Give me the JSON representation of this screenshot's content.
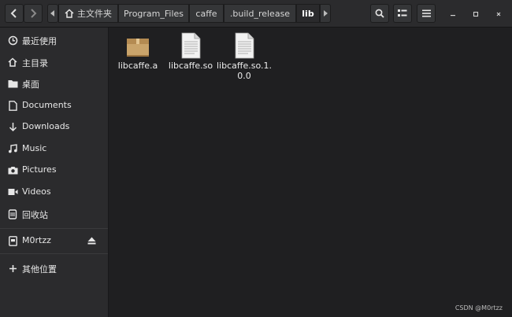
{
  "breadcrumbs": [
    "主文件夹",
    "Program_Files",
    "caffe",
    ".build_release",
    "lib"
  ],
  "sidebar": {
    "items": [
      {
        "label": "最近使用",
        "icon": "clock-icon"
      },
      {
        "label": "主目录",
        "icon": "home-icon"
      },
      {
        "label": "桌面",
        "icon": "folder-icon"
      },
      {
        "label": "Documents",
        "icon": "document-icon"
      },
      {
        "label": "Downloads",
        "icon": "download-icon"
      },
      {
        "label": "Music",
        "icon": "music-icon"
      },
      {
        "label": "Pictures",
        "icon": "camera-icon"
      },
      {
        "label": "Videos",
        "icon": "video-icon"
      },
      {
        "label": "回收站",
        "icon": "trash-icon"
      }
    ],
    "devices": [
      {
        "label": "M0rtzz",
        "icon": "drive-icon"
      }
    ],
    "other": {
      "label": "其他位置",
      "icon": "plus-icon"
    }
  },
  "files": [
    {
      "name": "libcaffe.a",
      "icon": "archive-icon"
    },
    {
      "name": "libcaffe.so",
      "icon": "text-file-icon"
    },
    {
      "name": "libcaffe.so.1.0.0",
      "icon": "text-file-icon"
    }
  ],
  "watermark": "CSDN @M0rtzz",
  "colors": {
    "accent": "#2b2b2d",
    "background": "#1f1f21",
    "archive": "#c9a46b"
  }
}
